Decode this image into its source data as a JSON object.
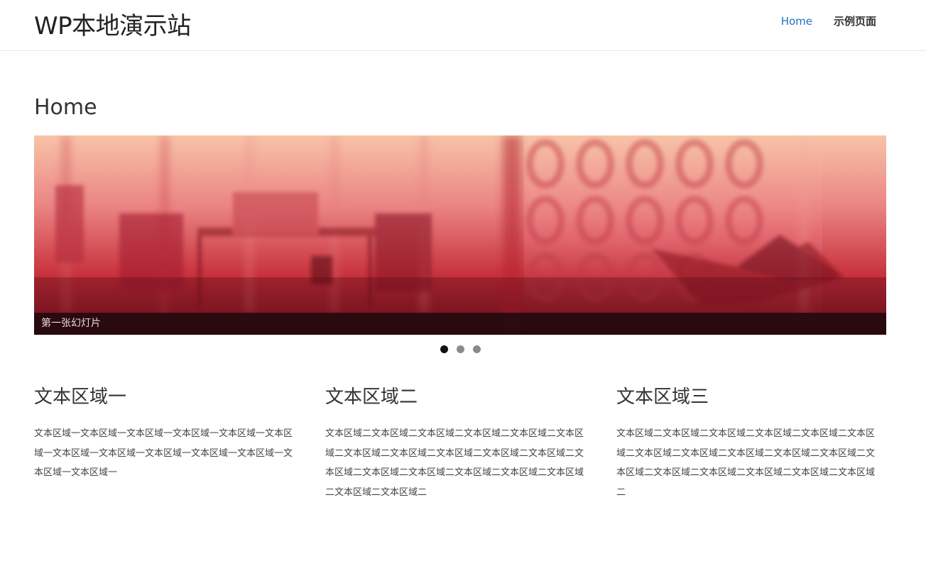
{
  "site": {
    "title": "WP本地演示站"
  },
  "nav": {
    "items": [
      {
        "label": "Home",
        "active": true
      },
      {
        "label": "示例页面",
        "active": false
      }
    ]
  },
  "page": {
    "title": "Home"
  },
  "slider": {
    "caption": "第一张幻灯片",
    "slide_count": 3,
    "active_slide": 1,
    "tint_color": "#c8323c"
  },
  "widgets": [
    {
      "title": "文本区域一",
      "body": "文本区域一文本区域一文本区域一文本区域一文本区域一文本区域一文本区域一文本区域一文本区域一文本区域一文本区域一文本区域一文本区域一"
    },
    {
      "title": "文本区域二",
      "body": "文本区域二文本区域二文本区域二文本区域二文本区域二文本区域二文本区域二文本区域二文本区域二文本区域二文本区域二文本区域二文本区域二文本区域二文本区域二文本区域二文本区域二文本区域二文本区域二"
    },
    {
      "title": "文本区域三",
      "body": "文本区域二文本区域二文本区域二文本区域二文本区域二文本区域二文本区域二文本区域二文本区域二文本区域二文本区域二文本区域二文本区域二文本区域二文本区域二文本区域二文本区域二"
    }
  ]
}
